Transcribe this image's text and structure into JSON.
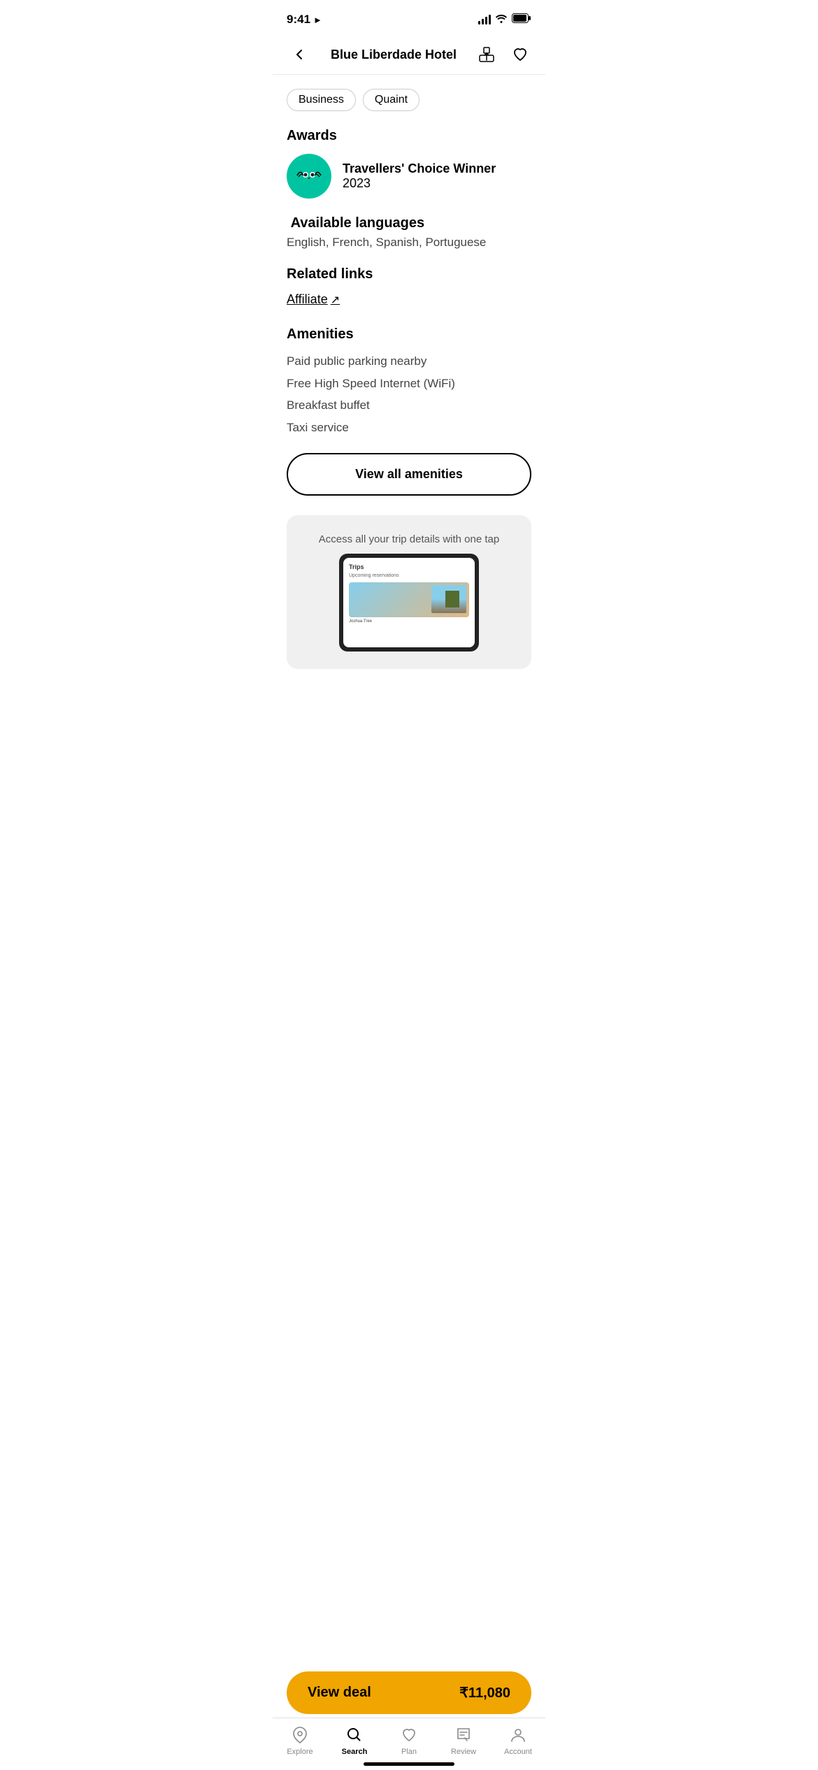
{
  "statusBar": {
    "time": "9:41",
    "hasLocation": true
  },
  "header": {
    "title": "Blue Liberdade Hotel",
    "backLabel": "Back",
    "shareLabel": "Share",
    "favoriteLabel": "Favorite"
  },
  "tags": [
    {
      "label": "Business"
    },
    {
      "label": "Quaint"
    }
  ],
  "awards": {
    "sectionTitle": "Awards",
    "items": [
      {
        "name": "Travellers' Choice Winner",
        "year": "2023"
      }
    ]
  },
  "languages": {
    "sectionTitle": "Available languages",
    "list": "English, French, Spanish, Portuguese"
  },
  "relatedLinks": {
    "sectionTitle": "Related links",
    "affiliateLabel": "Affiliate",
    "affiliateArrow": "↗"
  },
  "amenities": {
    "sectionTitle": "Amenities",
    "items": [
      "Paid public parking nearby",
      "Free High Speed Internet (WiFi)",
      "Breakfast buffet",
      "Taxi service"
    ],
    "viewAllLabel": "View all amenities"
  },
  "promo": {
    "text": "Access all your trip details with one tap",
    "deviceTitle": "Trips",
    "deviceSubtitle": "Upcoming reservations",
    "deviceLocation": "Joshua Tree"
  },
  "viewDeal": {
    "label": "View deal",
    "price": "₹11,080"
  },
  "bottomNav": {
    "items": [
      {
        "id": "explore",
        "label": "Explore",
        "active": false
      },
      {
        "id": "search",
        "label": "Search",
        "active": true
      },
      {
        "id": "plan",
        "label": "Plan",
        "active": false
      },
      {
        "id": "review",
        "label": "Review",
        "active": false
      },
      {
        "id": "account",
        "label": "Account",
        "active": false
      }
    ]
  }
}
